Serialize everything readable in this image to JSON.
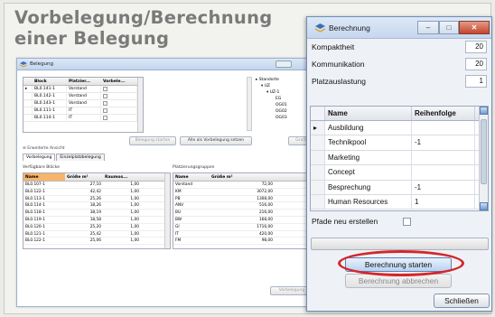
{
  "slide": {
    "title_line1": "Vorbelegung/Berechnung",
    "title_line2": "einer Belegung"
  },
  "main_window": {
    "title": "Belegung",
    "blocks_grid": {
      "columns": [
        "Block",
        "Platzier...",
        "Vorbele..."
      ],
      "rows": [
        {
          "block": "BL0.141-1",
          "platz": "Vorstand"
        },
        {
          "block": "BL0.142-1",
          "platz": "Vorstand"
        },
        {
          "block": "BL0.143-1",
          "platz": "Vorstand"
        },
        {
          "block": "BL0.111-1",
          "platz": "IT"
        },
        {
          "block": "BL0.114-1",
          "platz": "IT"
        }
      ]
    },
    "tree": {
      "root": "Standorte",
      "items": [
        "UZ",
        "UZ-1",
        "EG",
        "OG01",
        "OG02",
        "OG03"
      ]
    },
    "buttons": {
      "berechnung_starten": "Belegung starten",
      "alle_vorbelegung": "Alle als Vorbelegung setzen",
      "grafik": "Grafik"
    },
    "expander": "Erweiterte Ansicht",
    "tabs": [
      "Vorbelegung",
      "Einzelplatzbelegung"
    ],
    "left_section": "Verfügbare Blöcke",
    "right_section": "Platzierungsgruppen",
    "available_grid": {
      "columns": [
        "Name",
        "Größe m²",
        "Raumos..."
      ],
      "rows": [
        [
          "BL0.107-1",
          "27,10",
          "1,00"
        ],
        [
          "BL0.122-1",
          "42,42",
          "1,00"
        ],
        [
          "BL0.113-1",
          "25,26",
          "1,00"
        ],
        [
          "BL0.114-1",
          "18,26",
          "1,00"
        ],
        [
          "BL0.118-1",
          "38,19",
          "1,00"
        ],
        [
          "BL0.119-1",
          "18,58",
          "1,00"
        ],
        [
          "BL0.120-1",
          "25,20",
          "1,00"
        ],
        [
          "BL0.121-1",
          "25,42",
          "1,00"
        ],
        [
          "BL0.122-1",
          "25,06",
          "1,00"
        ]
      ]
    },
    "groups_grid": {
      "columns": [
        "Name",
        "Größe m²"
      ],
      "rows": [
        [
          "Vorstand",
          "72,00"
        ],
        [
          "KM",
          "3072,00"
        ],
        [
          "PB",
          "1308,00"
        ],
        [
          "ANV",
          "516,00"
        ],
        [
          "BU",
          "216,00"
        ],
        [
          "BW",
          "168,00"
        ],
        [
          "GI",
          "1716,00"
        ],
        [
          "IT",
          "420,00"
        ],
        [
          "FM",
          "98,00"
        ]
      ]
    },
    "vorbelegung_button": "Vorbelegung"
  },
  "dialog": {
    "title": "Berechnung",
    "fields": [
      {
        "label": "Kompaktheit",
        "value": "20"
      },
      {
        "label": "Kommunikation",
        "value": "20"
      },
      {
        "label": "Platzauslastung",
        "value": "1"
      }
    ],
    "grid": {
      "columns": [
        "Name",
        "Reihenfolge"
      ],
      "rows": [
        {
          "name": "Ausbildung",
          "order": ""
        },
        {
          "name": "Technikpool",
          "order": "-1"
        },
        {
          "name": "Marketing",
          "order": ""
        },
        {
          "name": "Concept",
          "order": ""
        },
        {
          "name": "Besprechung",
          "order": "-1"
        },
        {
          "name": "Human Resources",
          "order": "1"
        }
      ]
    },
    "pfade_label": "Pfade neu erstellen",
    "progress": 0,
    "start_button": "Berechnung starten",
    "abort_button": "Berechnung abbrechen",
    "close_button": "Schließen",
    "controls": {
      "minimize": "–",
      "maximize": "□",
      "close": "✕"
    },
    "accent_color": "#d4262b"
  }
}
